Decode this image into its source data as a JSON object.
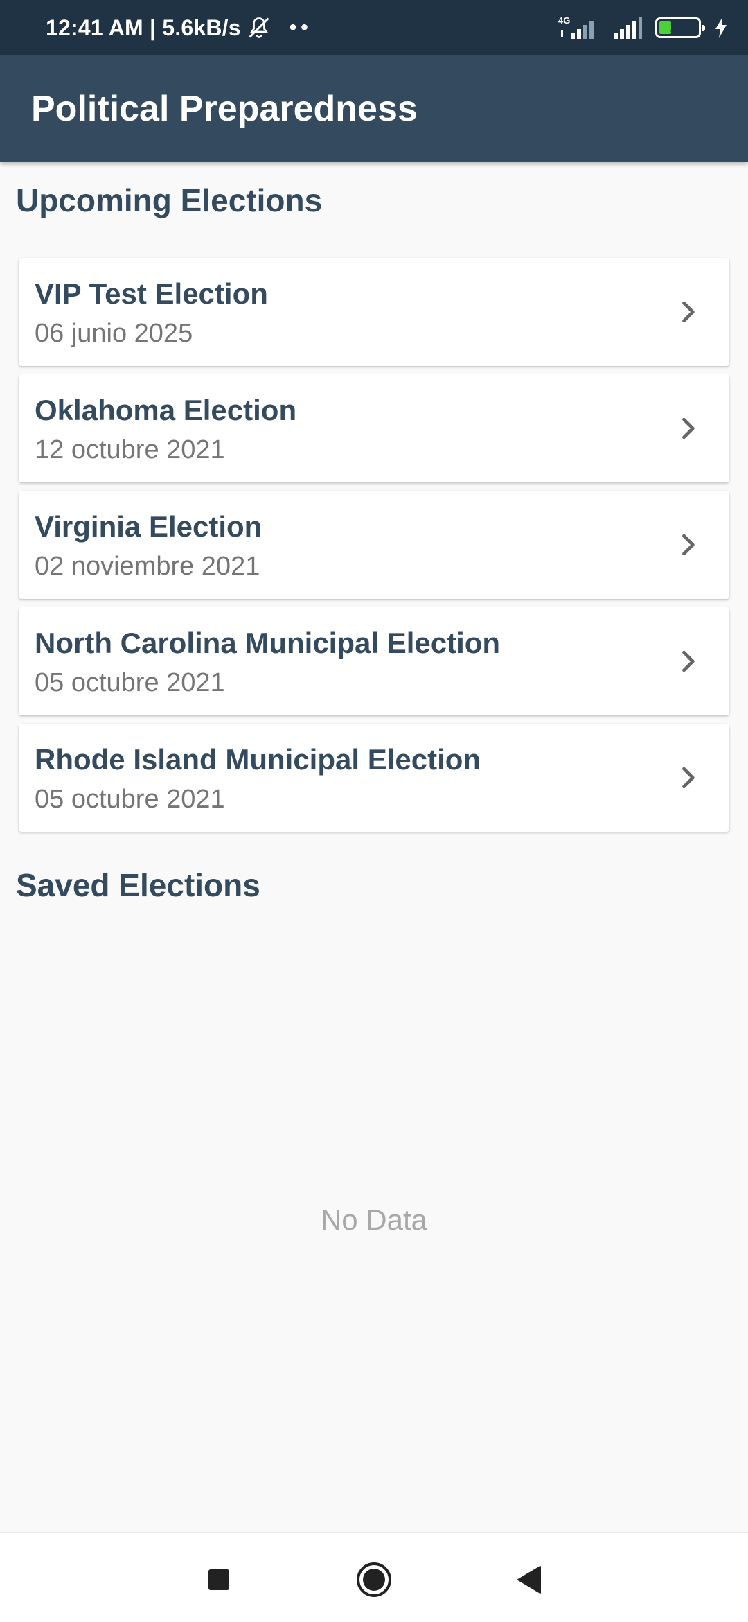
{
  "status_bar": {
    "time_speed": "12:41 AM | 5.6kB/s",
    "dots": "••",
    "network_label": "4G",
    "battery_level": "29",
    "battery_color": "#4cd137",
    "icons": [
      "mute-icon",
      "signal-4g-icon",
      "signal-icon",
      "battery-icon",
      "charging-icon"
    ]
  },
  "app_bar": {
    "title": "Political Preparedness",
    "background": "#344a5e"
  },
  "upcoming": {
    "title": "Upcoming Elections",
    "elections": [
      {
        "name": "VIP Test Election",
        "date": "06 junio 2025"
      },
      {
        "name": "Oklahoma Election",
        "date": "12 octubre 2021"
      },
      {
        "name": "Virginia Election",
        "date": "02 noviembre 2021"
      },
      {
        "name": "North Carolina Municipal Election",
        "date": "05 octubre 2021"
      },
      {
        "name": "Rhode Island Municipal Election",
        "date": "05 octubre 2021"
      }
    ]
  },
  "saved": {
    "title": "Saved Elections",
    "empty_text": "No Data"
  },
  "nav_bar": {
    "icons": [
      "recents-square-icon",
      "home-circle-icon",
      "back-triangle-icon"
    ]
  }
}
